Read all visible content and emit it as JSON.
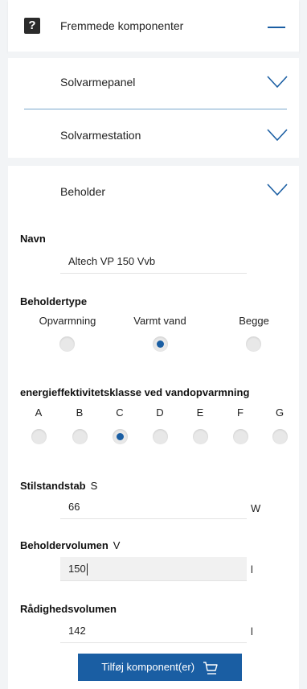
{
  "header": {
    "title": "Fremmede komponenter",
    "help_icon": "question-mark-icon",
    "collapse_icon": "minus-icon"
  },
  "accordion": [
    {
      "label": "Solvarmepanel",
      "icon": "chevron-down-icon"
    },
    {
      "label": "Solvarmestation",
      "icon": "chevron-down-icon"
    },
    {
      "label": "Beholder",
      "icon": "chevron-down-icon"
    }
  ],
  "form": {
    "navn": {
      "label": "Navn",
      "value": "Altech VP 150 Vvb"
    },
    "beholdertype": {
      "label": "Beholdertype",
      "options": [
        {
          "label": "Opvarmning",
          "selected": false
        },
        {
          "label": "Varmt vand",
          "selected": true
        },
        {
          "label": "Begge",
          "selected": false
        }
      ]
    },
    "energiklasse": {
      "label": "energieffektivitetsklasse ved vandopvarmning",
      "options": [
        {
          "label": "A",
          "selected": false
        },
        {
          "label": "B",
          "selected": false
        },
        {
          "label": "C",
          "selected": true
        },
        {
          "label": "D",
          "selected": false
        },
        {
          "label": "E",
          "selected": false
        },
        {
          "label": "F",
          "selected": false
        },
        {
          "label": "G",
          "selected": false
        }
      ]
    },
    "stilstandstab": {
      "label": "Stilstandstab",
      "symbol": "S",
      "value": "66",
      "unit": "W"
    },
    "beholdervolumen": {
      "label": "Beholdervolumen",
      "symbol": "V",
      "value": "150",
      "unit": "l"
    },
    "raadighedsvolumen": {
      "label": "Rådighedsvolumen",
      "value": "142",
      "unit": "l"
    }
  },
  "add_button": {
    "label": "Tilføj komponent(er)",
    "icon": "cart-icon"
  },
  "colors": {
    "accent": "#1a5ea3",
    "background": "#f2f4f6"
  }
}
